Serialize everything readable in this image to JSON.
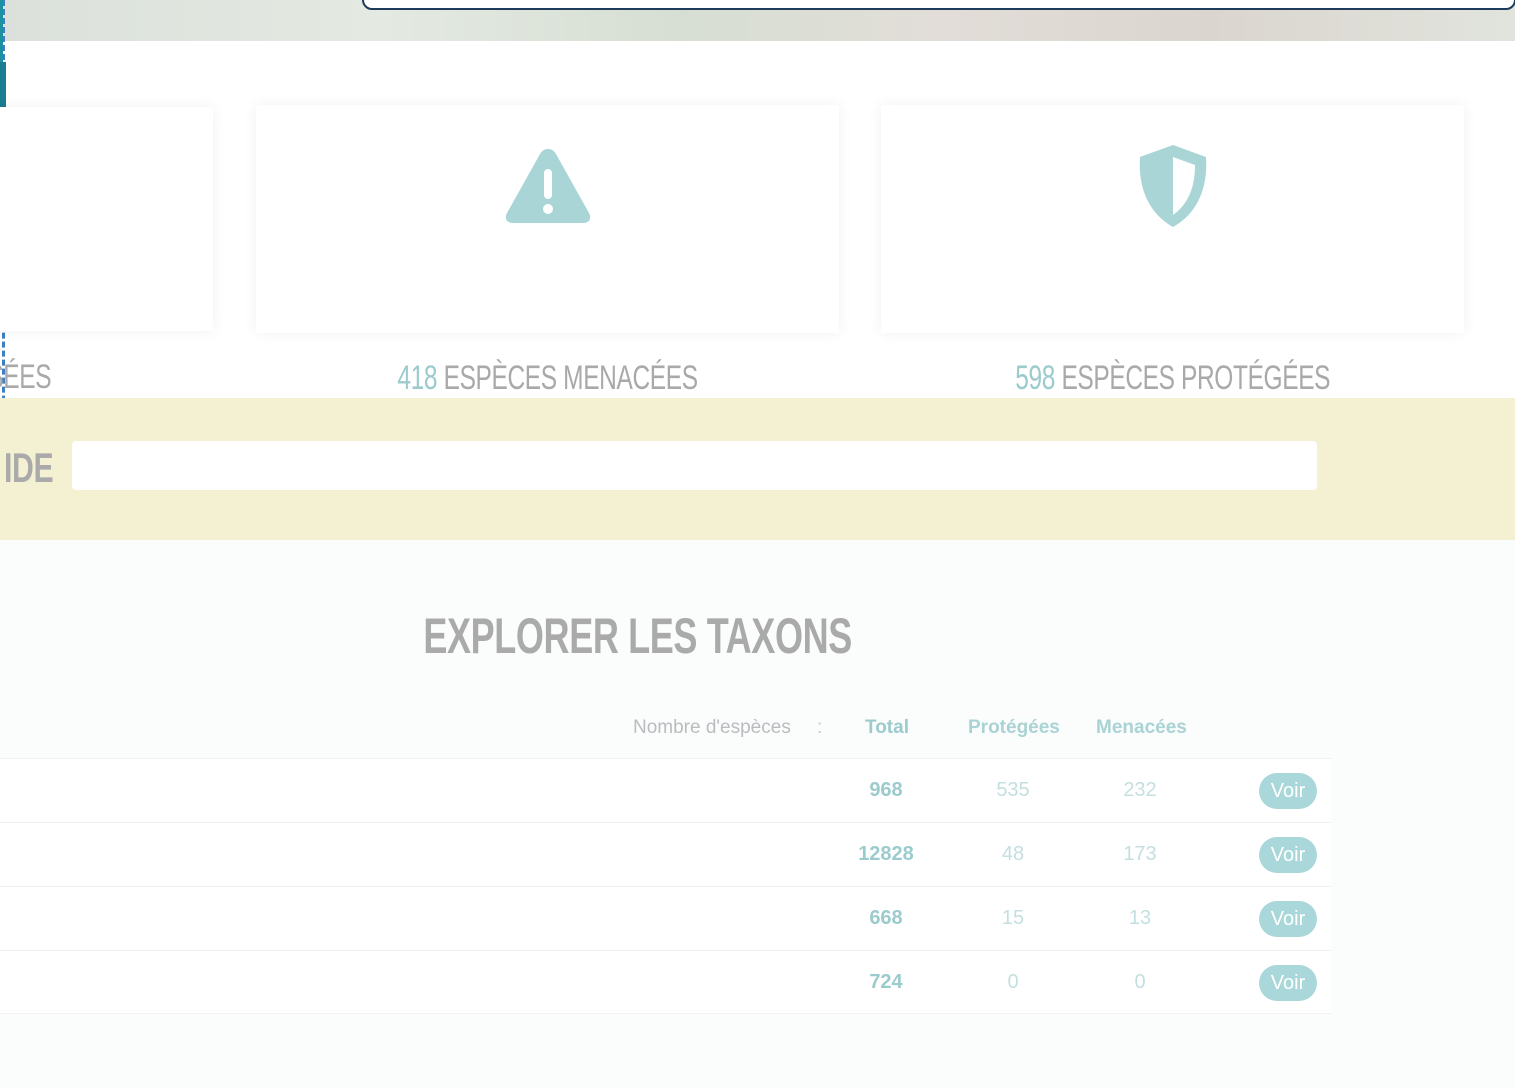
{
  "stats": [
    {
      "number": "",
      "text": "NSÉES",
      "icon": ""
    },
    {
      "number": "418",
      "text": "ESPÈCES MENACÉES",
      "icon": "warning-icon"
    },
    {
      "number": "598",
      "text": "ESPÈCES PROTÉGÉES",
      "icon": "shield-icon"
    }
  ],
  "search": {
    "title": "IDE",
    "value": "",
    "placeholder": ""
  },
  "explorer": {
    "title": "EXPLORER LES TAXONS",
    "header": {
      "label": "Nombre d'espèces",
      "colon": ":",
      "total": "Total",
      "protected": "Protégées",
      "threatened": "Menacées"
    },
    "rows": [
      {
        "total": "968",
        "protected": "535",
        "threatened": "232",
        "button": "Voir"
      },
      {
        "total": "12828",
        "protected": "48",
        "threatened": "173",
        "button": "Voir"
      },
      {
        "total": "668",
        "protected": "15",
        "threatened": "13",
        "button": "Voir"
      },
      {
        "total": "724",
        "protected": "0",
        "threatened": "0",
        "button": "Voir"
      }
    ]
  },
  "colors": {
    "accent": "#9ccbcd",
    "button": "#aad8da",
    "band": "#f4f1d3",
    "heading": "#aaaaaa"
  }
}
